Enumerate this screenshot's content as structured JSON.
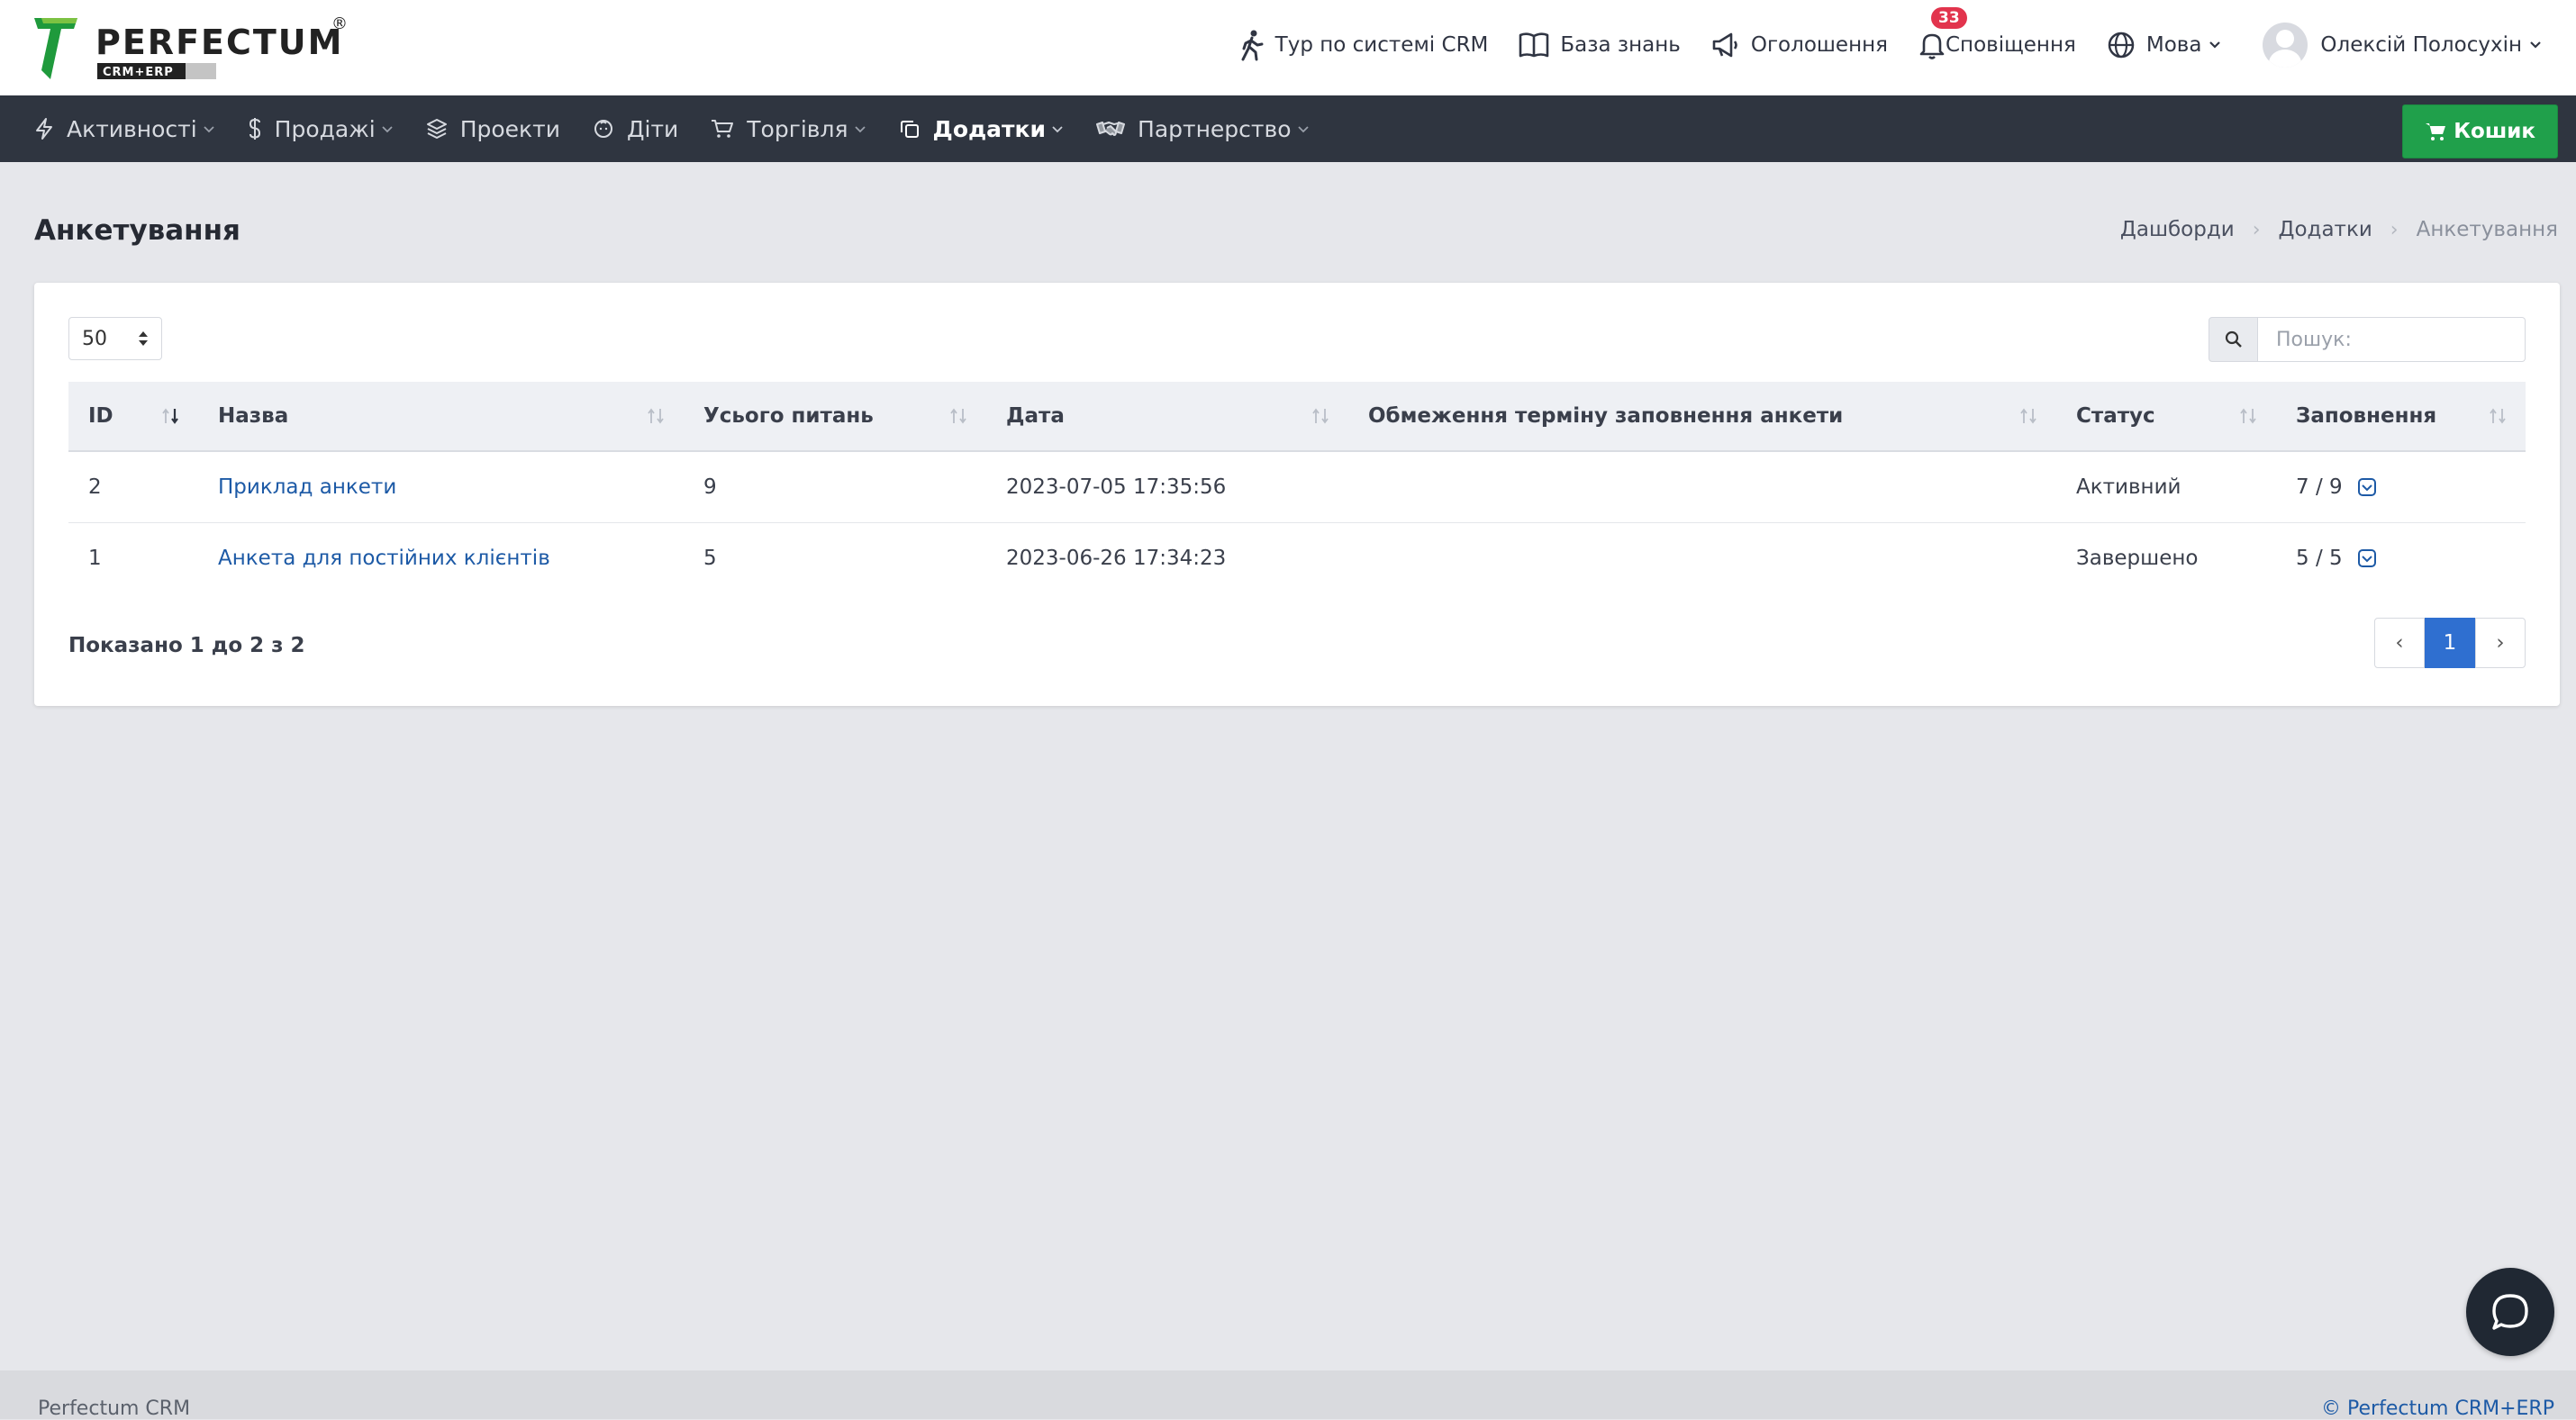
{
  "brand": {
    "name": "PERFECTUM",
    "sub": "CRM+ERP",
    "reg": "®"
  },
  "topnav": {
    "tour": "Тур по системі CRM",
    "kb": "База знань",
    "announcements": "Оголошення",
    "notifications": "Сповіщення",
    "notifications_count": "33",
    "language": "Мова",
    "user": "Олексій Полосухін"
  },
  "mainnav": {
    "items": [
      {
        "label": "Активності",
        "icon": "bolt-icon"
      },
      {
        "label": "Продажі",
        "icon": "dollar-icon"
      },
      {
        "label": "Проекти",
        "icon": "layers-icon"
      },
      {
        "label": "Діти",
        "icon": "baby-icon"
      },
      {
        "label": "Торгівля",
        "icon": "cart-icon"
      },
      {
        "label": "Додатки",
        "icon": "copy-icon"
      },
      {
        "label": "Партнерство",
        "icon": "handshake-icon"
      }
    ],
    "cart_button": "Кошик"
  },
  "page": {
    "title": "Анкетування",
    "breadcrumb": [
      "Дашборди",
      "Додатки",
      "Анкетування"
    ]
  },
  "table": {
    "page_length": "50",
    "search_placeholder": "Пошук:",
    "columns": [
      "ID",
      "Назва",
      "Усього питань",
      "Дата",
      "Обмеження терміну заповнення анкети",
      "Статус",
      "Заповнення"
    ],
    "rows": [
      {
        "id": "2",
        "name": "Приклад анкети",
        "questions": "9",
        "date": "2023-07-05 17:35:56",
        "limit": "",
        "status": "Активний",
        "fill": "7 / 9"
      },
      {
        "id": "1",
        "name": "Анкета для постійних клієнтів",
        "questions": "5",
        "date": "2023-06-26 17:34:23",
        "limit": "",
        "status": "Завершено",
        "fill": "5 / 5"
      }
    ],
    "info": "Показано 1 до 2 з 2",
    "pagination": {
      "prev": "‹",
      "current": "1",
      "next": "›"
    }
  },
  "footer": {
    "left": "Perfectum CRM",
    "right": "© Perfectum CRM+ERP"
  },
  "colors": {
    "nav_bg": "#2f3540",
    "cart": "#20a04b",
    "link": "#1d5aa6",
    "badge": "#e2344d",
    "page_active": "#2f6fd0"
  }
}
